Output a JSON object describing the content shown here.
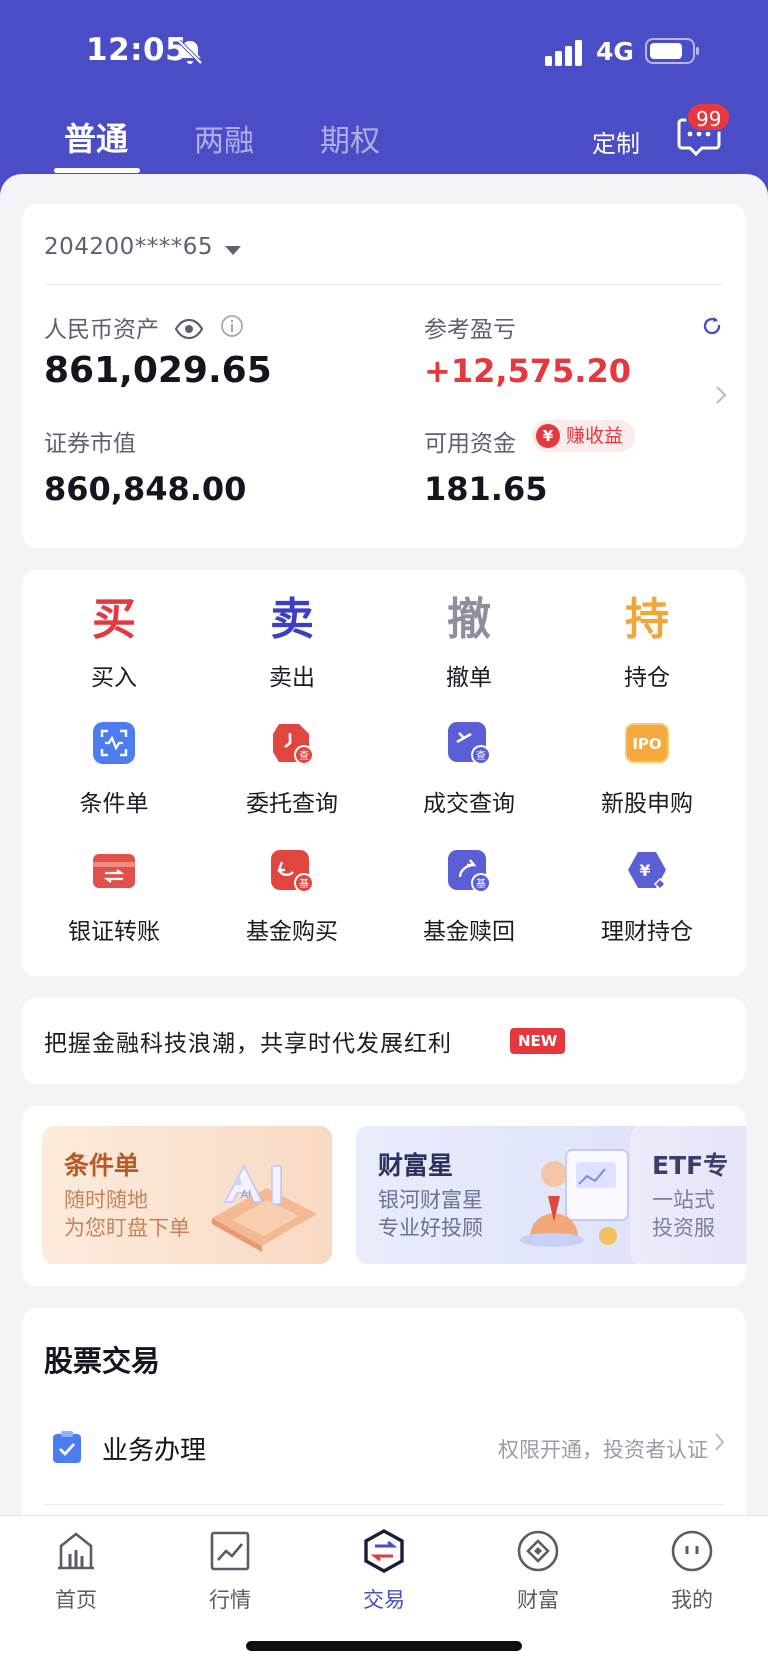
{
  "status_bar": {
    "time": "12:05",
    "network": "4G"
  },
  "header": {
    "tabs": [
      {
        "label": "普通",
        "active": true
      },
      {
        "label": "两融",
        "active": false
      },
      {
        "label": "期权",
        "active": false
      }
    ],
    "customize_label": "定制",
    "message_badge": "99"
  },
  "asset": {
    "account": "204200****65",
    "rmb_asset_label": "人民币资产",
    "rmb_asset_value": "861,029.65",
    "pnl_label": "参考盈亏",
    "pnl_value": "+12,575.20",
    "securities_label": "证券市值",
    "securities_value": "860,848.00",
    "available_label": "可用资金",
    "available_value": "181.65",
    "earn_tag": "赚收益",
    "earn_tag_icon": "¥"
  },
  "quick_actions": [
    {
      "char": "买",
      "label": "买入",
      "color": "#E5383E"
    },
    {
      "char": "卖",
      "label": "卖出",
      "color": "#3A3FC4"
    },
    {
      "char": "撤",
      "label": "撤单",
      "color": "#8D909C"
    },
    {
      "char": "持",
      "label": "持仓",
      "color": "#F0A63A"
    }
  ],
  "functions": [
    {
      "label": "条件单",
      "icon": "scan-condition-icon"
    },
    {
      "label": "委托查询",
      "icon": "order-query-icon",
      "badge": "查"
    },
    {
      "label": "成交查询",
      "icon": "deal-query-icon",
      "badge": "查"
    },
    {
      "label": "新股申购",
      "icon": "ipo-icon",
      "text": "IPO"
    },
    {
      "label": "银证转账",
      "icon": "bank-transfer-icon"
    },
    {
      "label": "基金购买",
      "icon": "fund-buy-icon",
      "badge": "基"
    },
    {
      "label": "基金赎回",
      "icon": "fund-redeem-icon",
      "badge": "基"
    },
    {
      "label": "理财持仓",
      "icon": "wealth-holding-icon",
      "text": "¥"
    }
  ],
  "slogan": {
    "text": "把握金融科技浪潮，共享时代发展红利",
    "badge": "NEW"
  },
  "promos": [
    {
      "title": "条件单",
      "line1": "随时随地",
      "line2": "为您盯盘下单",
      "art": "AI"
    },
    {
      "title": "财富星",
      "line1": "银河财富星",
      "line2": "专业好投顾"
    },
    {
      "title": "ETF专",
      "line1": "一站式",
      "line2": "投资服"
    }
  ],
  "stock_trading": {
    "title": "股票交易",
    "business_label": "业务办理",
    "business_desc": "权限开通，投资者认证"
  },
  "tabbar": [
    {
      "label": "首页",
      "icon": "home-chart-icon",
      "active": false
    },
    {
      "label": "行情",
      "icon": "market-icon",
      "active": false
    },
    {
      "label": "交易",
      "icon": "trade-icon",
      "active": true
    },
    {
      "label": "财富",
      "icon": "wealth-icon",
      "active": false
    },
    {
      "label": "我的",
      "icon": "profile-icon",
      "active": false
    }
  ]
}
